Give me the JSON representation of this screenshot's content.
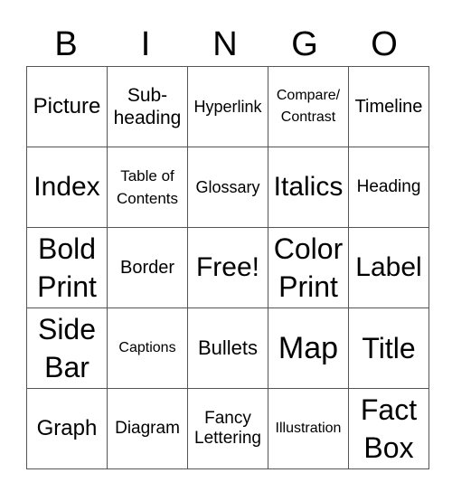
{
  "header": [
    "B",
    "I",
    "N",
    "G",
    "O"
  ],
  "rows": [
    [
      {
        "text": "Picture",
        "size": "s24"
      },
      {
        "text": "Sub-\nheading",
        "size": "s21"
      },
      {
        "text": "Hyperlink",
        "size": "s18"
      },
      {
        "text": "Compare/\nContrast",
        "size": "s16"
      },
      {
        "text": "Timeline",
        "size": "s20"
      }
    ],
    [
      {
        "text": "Index",
        "size": "s30"
      },
      {
        "text": "Table of\nContents",
        "size": "s17"
      },
      {
        "text": "Glossary",
        "size": "s18"
      },
      {
        "text": "Italics",
        "size": "s30"
      },
      {
        "text": "Heading",
        "size": "s19"
      }
    ],
    [
      {
        "text": "Bold\nPrint",
        "size": "s32"
      },
      {
        "text": "Border",
        "size": "s20"
      },
      {
        "text": "Free!",
        "size": "s30"
      },
      {
        "text": "Color\nPrint",
        "size": "s32"
      },
      {
        "text": "Label",
        "size": "s30"
      }
    ],
    [
      {
        "text": "Side\nBar",
        "size": "s32"
      },
      {
        "text": "Captions",
        "size": "s15"
      },
      {
        "text": "Bullets",
        "size": "s22"
      },
      {
        "text": "Map",
        "size": "s36"
      },
      {
        "text": "Title",
        "size": "s32"
      }
    ],
    [
      {
        "text": "Graph",
        "size": "s24"
      },
      {
        "text": "Diagram",
        "size": "s19"
      },
      {
        "text": "Fancy\nLettering",
        "size": "s19"
      },
      {
        "text": "Illustration",
        "size": "s14"
      },
      {
        "text": "Fact\nBox",
        "size": "s32"
      }
    ]
  ]
}
